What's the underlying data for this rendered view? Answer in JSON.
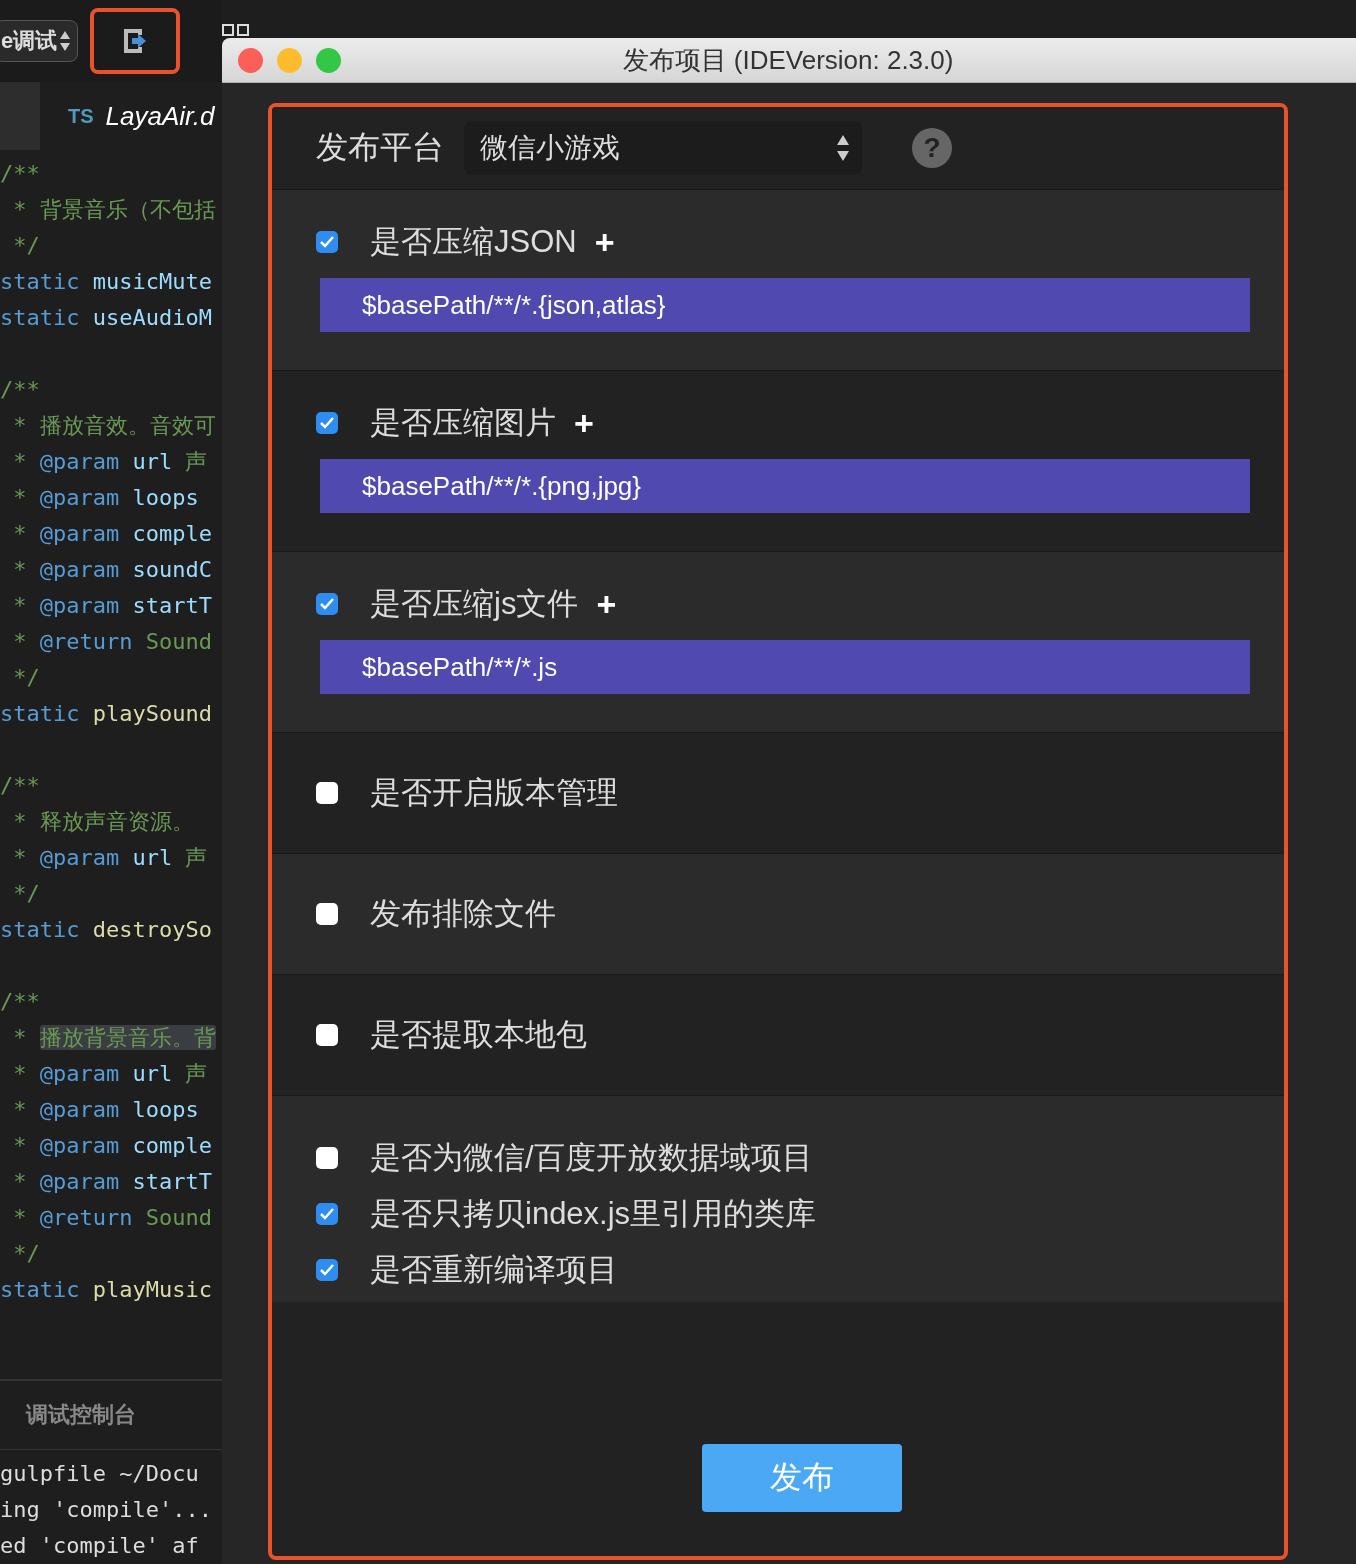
{
  "editor": {
    "run_selector": "e调试",
    "file_tab": {
      "badge": "TS",
      "name": "LayaAir.d"
    },
    "code_lines": [
      {
        "tokens": [
          {
            "kind": "comment",
            "text": "/**"
          }
        ]
      },
      {
        "tokens": [
          {
            "kind": "comment",
            "text": " * 背景音乐（不包括"
          }
        ]
      },
      {
        "tokens": [
          {
            "kind": "comment",
            "text": " */"
          }
        ]
      },
      {
        "tokens": [
          {
            "kind": "keyword",
            "text": "static"
          },
          {
            "kind": "name",
            "text": " musicMute"
          }
        ]
      },
      {
        "tokens": [
          {
            "kind": "keyword",
            "text": "static"
          },
          {
            "kind": "name",
            "text": " useAudioM"
          }
        ]
      },
      {
        "kind": "blank"
      },
      {
        "tokens": [
          {
            "kind": "comment",
            "text": "/**"
          }
        ]
      },
      {
        "tokens": [
          {
            "kind": "comment",
            "text": " * 播放音效。音效可"
          }
        ]
      },
      {
        "tokens": [
          {
            "kind": "comment",
            "text": " * "
          },
          {
            "kind": "tag",
            "text": "@param"
          },
          {
            "kind": "name",
            "text": " url"
          },
          {
            "kind": "comment",
            "text": " 声"
          }
        ]
      },
      {
        "tokens": [
          {
            "kind": "comment",
            "text": " * "
          },
          {
            "kind": "tag",
            "text": "@param"
          },
          {
            "kind": "name",
            "text": " loops"
          }
        ]
      },
      {
        "tokens": [
          {
            "kind": "comment",
            "text": " * "
          },
          {
            "kind": "tag",
            "text": "@param"
          },
          {
            "kind": "name",
            "text": " comple"
          }
        ]
      },
      {
        "tokens": [
          {
            "kind": "comment",
            "text": " * "
          },
          {
            "kind": "tag",
            "text": "@param"
          },
          {
            "kind": "name",
            "text": " soundC"
          }
        ]
      },
      {
        "tokens": [
          {
            "kind": "comment",
            "text": " * "
          },
          {
            "kind": "tag",
            "text": "@param"
          },
          {
            "kind": "name",
            "text": " startT"
          }
        ]
      },
      {
        "tokens": [
          {
            "kind": "comment",
            "text": " * "
          },
          {
            "kind": "tag",
            "text": "@return"
          },
          {
            "kind": "comment",
            "text": " Sound"
          }
        ]
      },
      {
        "tokens": [
          {
            "kind": "comment",
            "text": " */"
          }
        ]
      },
      {
        "tokens": [
          {
            "kind": "keyword",
            "text": "static"
          },
          {
            "kind": "func",
            "text": " playSound"
          }
        ]
      },
      {
        "kind": "blank"
      },
      {
        "tokens": [
          {
            "kind": "comment",
            "text": "/**"
          }
        ]
      },
      {
        "tokens": [
          {
            "kind": "comment",
            "text": " * 释放声音资源。"
          }
        ]
      },
      {
        "tokens": [
          {
            "kind": "comment",
            "text": " * "
          },
          {
            "kind": "tag",
            "text": "@param"
          },
          {
            "kind": "name",
            "text": " url"
          },
          {
            "kind": "comment",
            "text": " 声"
          }
        ]
      },
      {
        "tokens": [
          {
            "kind": "comment",
            "text": " */"
          }
        ]
      },
      {
        "tokens": [
          {
            "kind": "keyword",
            "text": "static"
          },
          {
            "kind": "func",
            "text": " destroySo"
          }
        ]
      },
      {
        "kind": "blank"
      },
      {
        "tokens": [
          {
            "kind": "comment",
            "text": "/**"
          }
        ]
      },
      {
        "tokens": [
          {
            "kind": "comment",
            "text": " * "
          },
          {
            "kind": "highlight",
            "text": "播放背景音乐。背"
          }
        ]
      },
      {
        "tokens": [
          {
            "kind": "comment",
            "text": " * "
          },
          {
            "kind": "tag",
            "text": "@param"
          },
          {
            "kind": "name",
            "text": " url"
          },
          {
            "kind": "comment",
            "text": " 声"
          }
        ]
      },
      {
        "tokens": [
          {
            "kind": "comment",
            "text": " * "
          },
          {
            "kind": "tag",
            "text": "@param"
          },
          {
            "kind": "name",
            "text": " loops"
          }
        ]
      },
      {
        "tokens": [
          {
            "kind": "comment",
            "text": " * "
          },
          {
            "kind": "tag",
            "text": "@param"
          },
          {
            "kind": "name",
            "text": " comple"
          }
        ]
      },
      {
        "tokens": [
          {
            "kind": "comment",
            "text": " * "
          },
          {
            "kind": "tag",
            "text": "@param"
          },
          {
            "kind": "name",
            "text": " startT"
          }
        ]
      },
      {
        "tokens": [
          {
            "kind": "comment",
            "text": " * "
          },
          {
            "kind": "tag",
            "text": "@return"
          },
          {
            "kind": "comment",
            "text": " Sound"
          }
        ]
      },
      {
        "tokens": [
          {
            "kind": "comment",
            "text": " */"
          }
        ]
      },
      {
        "tokens": [
          {
            "kind": "keyword",
            "text": "static"
          },
          {
            "kind": "func",
            "text": " playMusic"
          }
        ]
      }
    ],
    "console_tab": "调试控制台",
    "console_lines": [
      "gulpfile ~/Docu",
      "ing 'compile'...",
      "ed 'compile' af"
    ]
  },
  "dialog": {
    "title": "发布项目 (IDEVersion: 2.3.0)",
    "platform": {
      "label": "发布平台",
      "value": "微信小游戏",
      "help": "?"
    },
    "sections": [
      {
        "options": [
          {
            "label": "是否压缩JSON",
            "checked": true,
            "add": "+",
            "pattern": "$basePath/**/*.{json,atlas}"
          }
        ]
      },
      {
        "options": [
          {
            "label": "是否压缩图片",
            "checked": true,
            "add": "+",
            "pattern": "$basePath/**/*.{png,jpg}"
          }
        ]
      },
      {
        "options": [
          {
            "label": "是否压缩js文件",
            "checked": true,
            "add": "+",
            "pattern": "$basePath/**/*.js"
          }
        ]
      },
      {
        "options": [
          {
            "label": "是否开启版本管理",
            "checked": false
          }
        ]
      },
      {
        "options": [
          {
            "label": "发布排除文件",
            "checked": false
          }
        ]
      },
      {
        "options": [
          {
            "label": "是否提取本地包",
            "checked": false
          }
        ]
      },
      {
        "options": [
          {
            "label": "是否为微信/百度开放数据域项目",
            "checked": false
          },
          {
            "label": "是否只拷贝index.js里引用的类库",
            "checked": true
          },
          {
            "label": "是否重新编译项目",
            "checked": true
          }
        ]
      }
    ],
    "publish_button": "发布"
  }
}
